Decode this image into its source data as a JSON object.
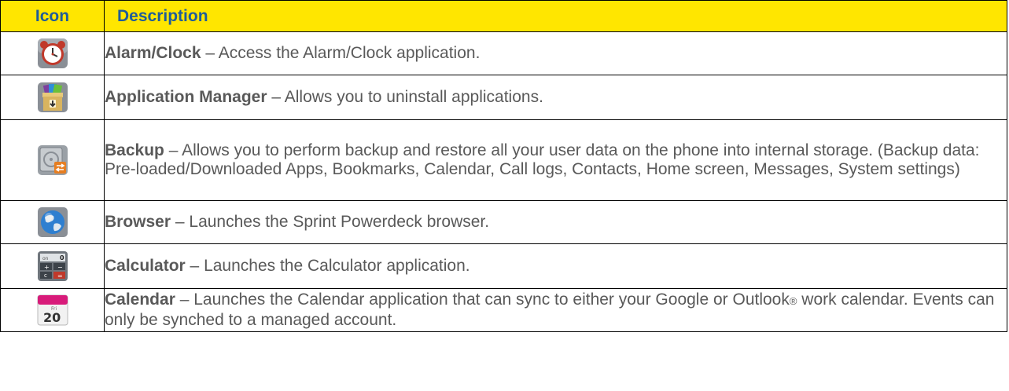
{
  "header": {
    "icon": "Icon",
    "description": "Description"
  },
  "rows": [
    {
      "icon": "alarm-clock-icon",
      "title": "Alarm/Clock",
      "dash": " – ",
      "text": "Access the Alarm/Clock application."
    },
    {
      "icon": "application-manager-icon",
      "title": "Application Manager",
      "dash": " – ",
      "text": "Allows you to uninstall applications."
    },
    {
      "icon": "backup-icon",
      "title": "Backup",
      "dash": " – ",
      "text": "Allows you to perform backup and restore all your user data on the phone into internal storage. (Backup data: Pre-loaded/Downloaded Apps, Bookmarks, Calendar, Call logs, Contacts, Home screen, Messages, System settings)"
    },
    {
      "icon": "browser-globe-icon",
      "title": "Browser",
      "dash": " – ",
      "text": "Launches the Sprint Powerdeck browser."
    },
    {
      "icon": "calculator-icon",
      "title": "Calculator",
      "dash": " – ",
      "text": "Launches the Calculator application."
    },
    {
      "icon": "calendar-icon",
      "title": "Calendar",
      "dash": " – ",
      "text": "Launches the Calendar application that can sync to either your Google or Outlook",
      "registered": "®",
      "text_after": " work calendar. Events can only be synched to a managed account."
    }
  ],
  "icon_text": {
    "calc_on": "on",
    "calc_zero": "0",
    "calc_plus": "+",
    "calc_minus": "−",
    "calc_c": "c",
    "calc_equals": "=",
    "cal_day": "Fri",
    "cal_date": "20"
  },
  "colors": {
    "header_bg": "#FFE600",
    "header_text": "#1F5C99",
    "body_text": "#595959",
    "border": "#000000"
  }
}
